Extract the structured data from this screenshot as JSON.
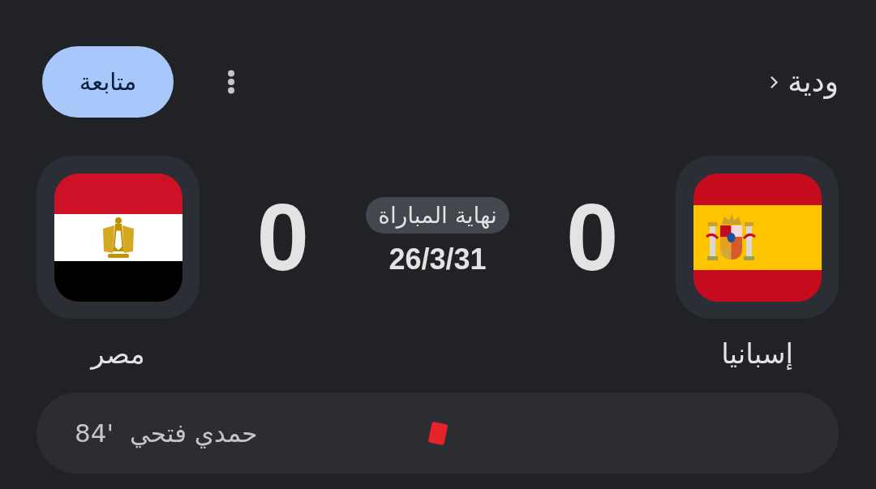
{
  "header": {
    "competition": "ودية",
    "follow_button": "متابعة"
  },
  "match": {
    "status": "نهاية المباراة",
    "date": "26/3/31",
    "teams": [
      {
        "name": "إسبانيا",
        "kind": "spain",
        "score": "0"
      },
      {
        "name": "مصر",
        "kind": "egypt",
        "score": "0"
      }
    ]
  },
  "events": [
    {
      "kind": "red_card",
      "player": "حمدي فتحي",
      "minute": "84'"
    }
  ]
}
